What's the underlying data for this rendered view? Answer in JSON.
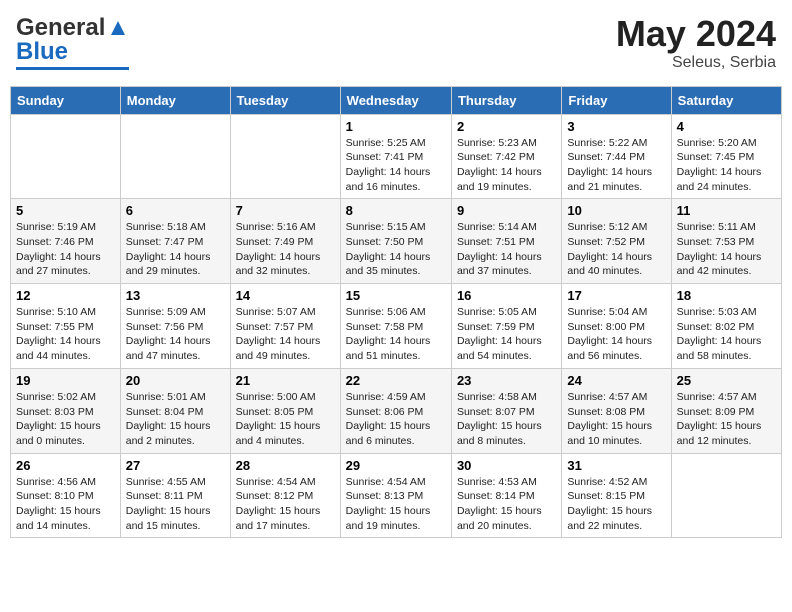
{
  "header": {
    "logo_general": "General",
    "logo_blue": "Blue",
    "month_year": "May 2024",
    "location": "Seleus, Serbia"
  },
  "days_of_week": [
    "Sunday",
    "Monday",
    "Tuesday",
    "Wednesday",
    "Thursday",
    "Friday",
    "Saturday"
  ],
  "weeks": [
    [
      {
        "day": "",
        "text": ""
      },
      {
        "day": "",
        "text": ""
      },
      {
        "day": "",
        "text": ""
      },
      {
        "day": "1",
        "text": "Sunrise: 5:25 AM\nSunset: 7:41 PM\nDaylight: 14 hours and 16 minutes."
      },
      {
        "day": "2",
        "text": "Sunrise: 5:23 AM\nSunset: 7:42 PM\nDaylight: 14 hours and 19 minutes."
      },
      {
        "day": "3",
        "text": "Sunrise: 5:22 AM\nSunset: 7:44 PM\nDaylight: 14 hours and 21 minutes."
      },
      {
        "day": "4",
        "text": "Sunrise: 5:20 AM\nSunset: 7:45 PM\nDaylight: 14 hours and 24 minutes."
      }
    ],
    [
      {
        "day": "5",
        "text": "Sunrise: 5:19 AM\nSunset: 7:46 PM\nDaylight: 14 hours and 27 minutes."
      },
      {
        "day": "6",
        "text": "Sunrise: 5:18 AM\nSunset: 7:47 PM\nDaylight: 14 hours and 29 minutes."
      },
      {
        "day": "7",
        "text": "Sunrise: 5:16 AM\nSunset: 7:49 PM\nDaylight: 14 hours and 32 minutes."
      },
      {
        "day": "8",
        "text": "Sunrise: 5:15 AM\nSunset: 7:50 PM\nDaylight: 14 hours and 35 minutes."
      },
      {
        "day": "9",
        "text": "Sunrise: 5:14 AM\nSunset: 7:51 PM\nDaylight: 14 hours and 37 minutes."
      },
      {
        "day": "10",
        "text": "Sunrise: 5:12 AM\nSunset: 7:52 PM\nDaylight: 14 hours and 40 minutes."
      },
      {
        "day": "11",
        "text": "Sunrise: 5:11 AM\nSunset: 7:53 PM\nDaylight: 14 hours and 42 minutes."
      }
    ],
    [
      {
        "day": "12",
        "text": "Sunrise: 5:10 AM\nSunset: 7:55 PM\nDaylight: 14 hours and 44 minutes."
      },
      {
        "day": "13",
        "text": "Sunrise: 5:09 AM\nSunset: 7:56 PM\nDaylight: 14 hours and 47 minutes."
      },
      {
        "day": "14",
        "text": "Sunrise: 5:07 AM\nSunset: 7:57 PM\nDaylight: 14 hours and 49 minutes."
      },
      {
        "day": "15",
        "text": "Sunrise: 5:06 AM\nSunset: 7:58 PM\nDaylight: 14 hours and 51 minutes."
      },
      {
        "day": "16",
        "text": "Sunrise: 5:05 AM\nSunset: 7:59 PM\nDaylight: 14 hours and 54 minutes."
      },
      {
        "day": "17",
        "text": "Sunrise: 5:04 AM\nSunset: 8:00 PM\nDaylight: 14 hours and 56 minutes."
      },
      {
        "day": "18",
        "text": "Sunrise: 5:03 AM\nSunset: 8:02 PM\nDaylight: 14 hours and 58 minutes."
      }
    ],
    [
      {
        "day": "19",
        "text": "Sunrise: 5:02 AM\nSunset: 8:03 PM\nDaylight: 15 hours and 0 minutes."
      },
      {
        "day": "20",
        "text": "Sunrise: 5:01 AM\nSunset: 8:04 PM\nDaylight: 15 hours and 2 minutes."
      },
      {
        "day": "21",
        "text": "Sunrise: 5:00 AM\nSunset: 8:05 PM\nDaylight: 15 hours and 4 minutes."
      },
      {
        "day": "22",
        "text": "Sunrise: 4:59 AM\nSunset: 8:06 PM\nDaylight: 15 hours and 6 minutes."
      },
      {
        "day": "23",
        "text": "Sunrise: 4:58 AM\nSunset: 8:07 PM\nDaylight: 15 hours and 8 minutes."
      },
      {
        "day": "24",
        "text": "Sunrise: 4:57 AM\nSunset: 8:08 PM\nDaylight: 15 hours and 10 minutes."
      },
      {
        "day": "25",
        "text": "Sunrise: 4:57 AM\nSunset: 8:09 PM\nDaylight: 15 hours and 12 minutes."
      }
    ],
    [
      {
        "day": "26",
        "text": "Sunrise: 4:56 AM\nSunset: 8:10 PM\nDaylight: 15 hours and 14 minutes."
      },
      {
        "day": "27",
        "text": "Sunrise: 4:55 AM\nSunset: 8:11 PM\nDaylight: 15 hours and 15 minutes."
      },
      {
        "day": "28",
        "text": "Sunrise: 4:54 AM\nSunset: 8:12 PM\nDaylight: 15 hours and 17 minutes."
      },
      {
        "day": "29",
        "text": "Sunrise: 4:54 AM\nSunset: 8:13 PM\nDaylight: 15 hours and 19 minutes."
      },
      {
        "day": "30",
        "text": "Sunrise: 4:53 AM\nSunset: 8:14 PM\nDaylight: 15 hours and 20 minutes."
      },
      {
        "day": "31",
        "text": "Sunrise: 4:52 AM\nSunset: 8:15 PM\nDaylight: 15 hours and 22 minutes."
      },
      {
        "day": "",
        "text": ""
      }
    ]
  ]
}
